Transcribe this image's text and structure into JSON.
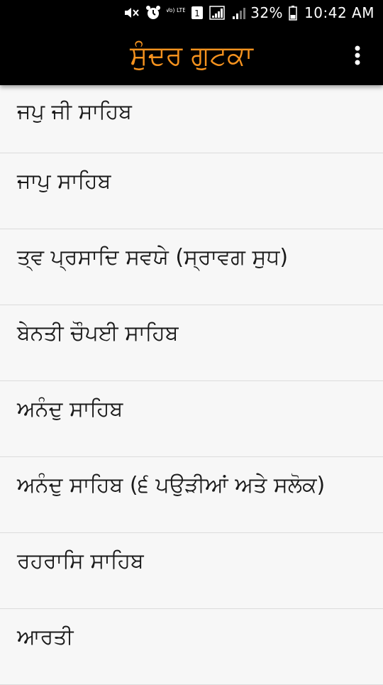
{
  "status_bar": {
    "battery_percent": "32%",
    "time": "10:42 AM",
    "volte_label": "Vo) LTE",
    "sim_label": "1",
    "icons": [
      "mute-icon",
      "alarm-icon",
      "volte-icon",
      "sim-icon",
      "signal-icon",
      "signal-weak-icon",
      "battery-icon"
    ]
  },
  "app_bar": {
    "title": "ਸੁੰਦਰ ਗੁਟਕਾ",
    "title_color": "#f5921e",
    "overflow_icon": "more-vert-icon"
  },
  "bani_list": [
    {
      "label": "ਜਪੁ ਜੀ ਸਾਹਿਬ"
    },
    {
      "label": "ਜਾਪੁ ਸਾਹਿਬ"
    },
    {
      "label": "ਤ੍ਵ ਪ੍ਰਸਾਦਿ ਸਵਯੇ (ਸ੍ਰਾਵਗ ਸੁਧ)"
    },
    {
      "label": "ਬੇਨਤੀ ਚੌਪਈ ਸਾਹਿਬ"
    },
    {
      "label": "ਅਨੰਦੁ ਸਾਹਿਬ"
    },
    {
      "label": "ਅਨੰਦੁ ਸਾਹਿਬ (੬ ਪਉੜੀਆਂ ਅਤੇ ਸਲੋਕ)"
    },
    {
      "label": "ਰਹਰਾਸਿ ਸਾਹਿਬ"
    },
    {
      "label": "ਆਰਤੀ"
    }
  ]
}
